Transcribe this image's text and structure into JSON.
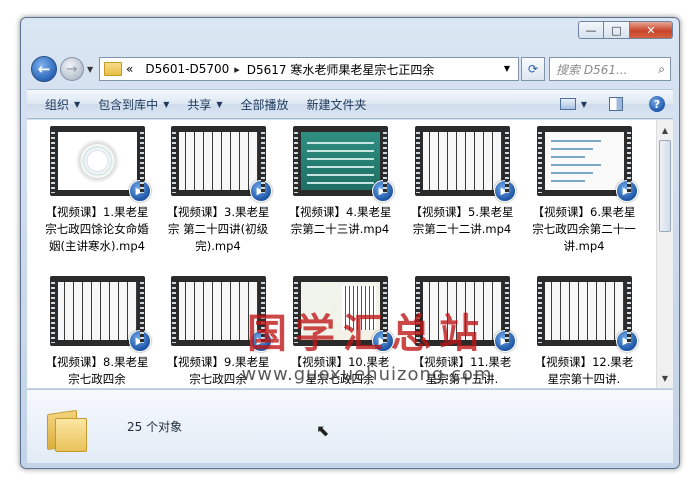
{
  "window": {
    "caption_buttons": {
      "minimize": "—",
      "maximize": "□",
      "close": "✕"
    }
  },
  "address": {
    "prefix": "«",
    "crumbs": [
      "D5601-D5700",
      "D5617 寒水老师果老星宗七正四余"
    ],
    "separator": "▸"
  },
  "search": {
    "placeholder": "搜索 D561..."
  },
  "toolbar": {
    "items": [
      {
        "label": "组织",
        "dropdown": true
      },
      {
        "label": "包含到库中",
        "dropdown": true
      },
      {
        "label": "共享",
        "dropdown": true
      },
      {
        "label": "全部播放",
        "dropdown": false
      },
      {
        "label": "新建文件夹",
        "dropdown": false
      }
    ]
  },
  "files": [
    {
      "name": "【视频课】1.果老星宗七政四馀论女命婚姻(主讲寒水).mp4",
      "thumb": "chart"
    },
    {
      "name": "【视频课】3.果老星宗 第二十四讲(初级完).mp4",
      "thumb": "lines"
    },
    {
      "name": "【视频课】4.果老星宗第二十三讲.mp4",
      "thumb": "dark"
    },
    {
      "name": "【视频课】5.果老星宗第二十二讲.mp4",
      "thumb": "lines"
    },
    {
      "name": "【视频课】6.果老星宗七政四余第二十一讲.mp4",
      "thumb": "text"
    },
    {
      "name": "【视频课】8.果老星宗七政四余",
      "thumb": "lines"
    },
    {
      "name": "【视频课】9.果老星宗七政四余",
      "thumb": "lines"
    },
    {
      "name": "【视频课】10.果老星宗七政四余",
      "thumb": "map"
    },
    {
      "name": "【视频课】11.果老星宗第十五讲.",
      "thumb": "lines"
    },
    {
      "name": "【视频课】12.果老星宗第十四讲.",
      "thumb": "lines"
    }
  ],
  "watermark": {
    "title": "国学汇总站",
    "url": "www.guoxuehuizong.com"
  },
  "details": {
    "count": "25 个对象"
  }
}
